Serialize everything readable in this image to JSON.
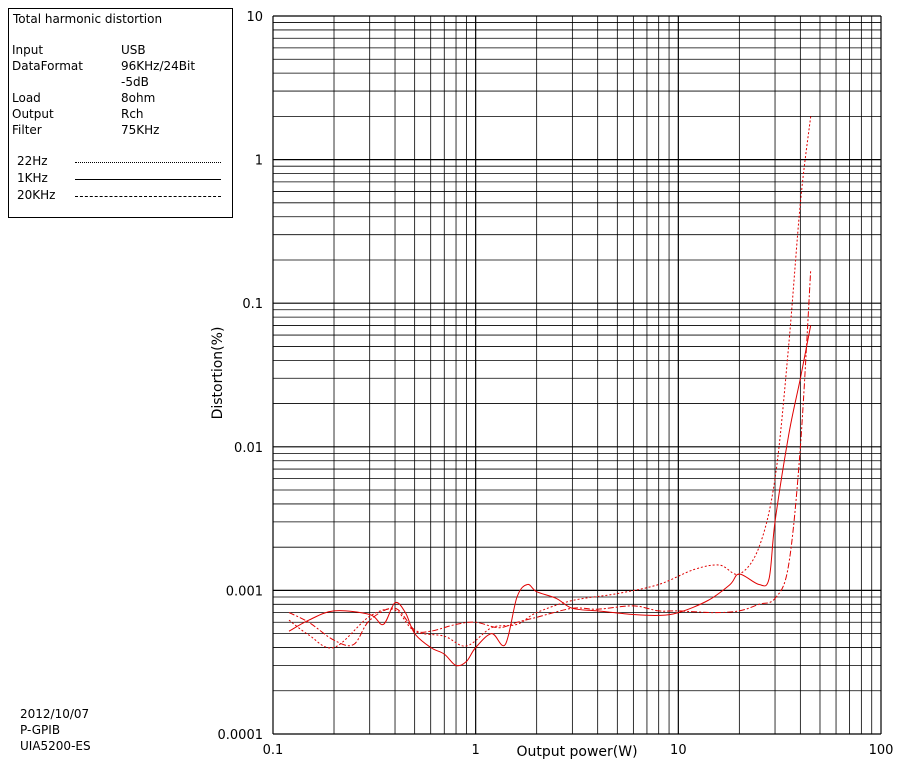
{
  "legend": {
    "title": "Total harmonic distortion",
    "rows": [
      {
        "key": "Input",
        "value": "USB"
      },
      {
        "key": "DataFormat",
        "value": "96KHz/24Bit"
      },
      {
        "key": "",
        "value": "-5dB"
      },
      {
        "key": "Load",
        "value": "8ohm"
      },
      {
        "key": "Output",
        "value": "Rch"
      },
      {
        "key": "Filter",
        "value": "75KHz"
      }
    ],
    "series": [
      {
        "label": "22Hz",
        "style": "dotted"
      },
      {
        "label": "1KHz",
        "style": "solid"
      },
      {
        "label": "20KHz",
        "style": "dashdot"
      }
    ]
  },
  "footer": {
    "date": "2012/10/07",
    "interface": "P-GPIB",
    "instrument": "UIA5200-ES"
  },
  "colors": {
    "grid": "#000000",
    "data": "#e00000"
  },
  "chart_data": {
    "type": "line",
    "xlabel": "Output power(W)",
    "ylabel": "Distortion(%)",
    "xscale": "log",
    "yscale": "log",
    "xlim": [
      0.1,
      100
    ],
    "ylim": [
      0.0001,
      10
    ],
    "xticks": [
      "0.1",
      "1",
      "10",
      "100"
    ],
    "yticks": [
      "0.0001",
      "0.001",
      "0.01",
      "0.1",
      "1",
      "10"
    ],
    "grid": true,
    "series": [
      {
        "name": "22Hz",
        "style": "dotted",
        "x": [
          0.12,
          0.15,
          0.2,
          0.3,
          0.4,
          0.5,
          0.7,
          0.9,
          1.2,
          1.6,
          2,
          3,
          5,
          8,
          12,
          16,
          20,
          25,
          30,
          35,
          40,
          45
        ],
        "y": [
          0.00062,
          0.00049,
          0.0004,
          0.00066,
          0.00073,
          0.00052,
          0.00048,
          0.00041,
          0.00055,
          0.00058,
          0.0007,
          0.00085,
          0.00095,
          0.0011,
          0.0014,
          0.0015,
          0.0013,
          0.002,
          0.006,
          0.05,
          0.5,
          2.0
        ]
      },
      {
        "name": "1KHz",
        "style": "solid",
        "x": [
          0.12,
          0.15,
          0.2,
          0.3,
          0.35,
          0.4,
          0.45,
          0.5,
          0.6,
          0.7,
          0.8,
          0.9,
          1.0,
          1.2,
          1.4,
          1.6,
          1.8,
          2.0,
          2.5,
          3,
          4,
          6,
          8,
          10,
          14,
          18,
          20,
          25,
          28,
          30,
          35,
          40,
          45
        ],
        "y": [
          0.00052,
          0.00062,
          0.00072,
          0.00068,
          0.00058,
          0.00082,
          0.0007,
          0.0005,
          0.0004,
          0.00036,
          0.0003,
          0.00032,
          0.0004,
          0.0005,
          0.00042,
          0.0009,
          0.0011,
          0.00098,
          0.00088,
          0.00075,
          0.00072,
          0.00068,
          0.00067,
          0.0007,
          0.00085,
          0.0011,
          0.0013,
          0.0011,
          0.0012,
          0.003,
          0.012,
          0.03,
          0.07
        ]
      },
      {
        "name": "20KHz",
        "style": "dashdot",
        "x": [
          0.12,
          0.15,
          0.2,
          0.25,
          0.3,
          0.4,
          0.5,
          0.6,
          0.8,
          1.0,
          1.3,
          1.6,
          2,
          3,
          4,
          6,
          8,
          10,
          15,
          20,
          25,
          30,
          35,
          40,
          45
        ],
        "y": [
          0.0007,
          0.0006,
          0.00045,
          0.00042,
          0.00062,
          0.00075,
          0.00053,
          0.00052,
          0.00058,
          0.0006,
          0.00055,
          0.0006,
          0.00065,
          0.00075,
          0.00074,
          0.00078,
          0.00072,
          0.00072,
          0.0007,
          0.00072,
          0.0008,
          0.00088,
          0.0015,
          0.01,
          0.17
        ]
      }
    ]
  }
}
